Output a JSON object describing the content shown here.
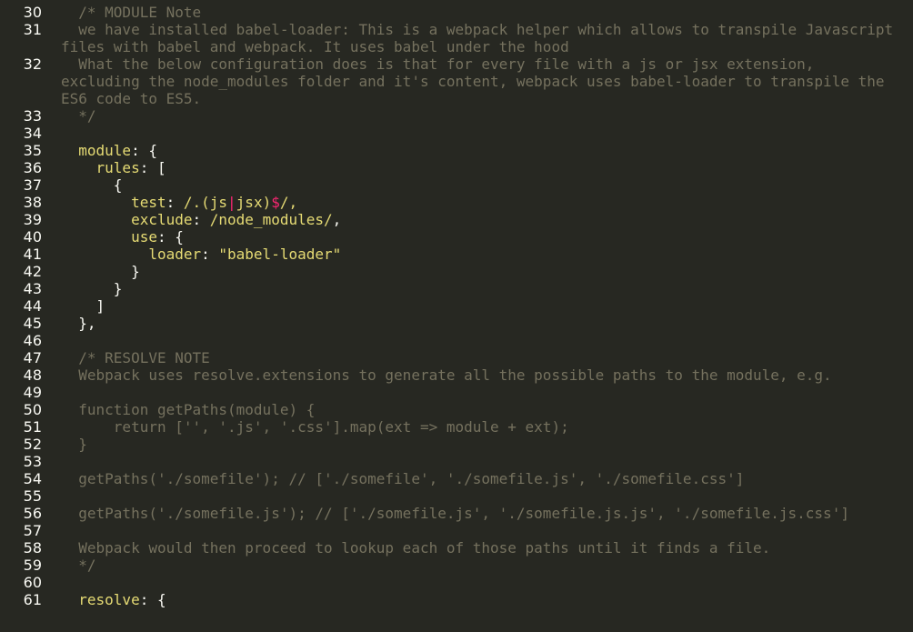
{
  "editor": {
    "lines": [
      {
        "n": "30",
        "text": "  /* MODULE Note"
      },
      {
        "n": "31",
        "text": "  we have installed babel-loader: This is a webpack helper which allows to transpile Javascript files with babel and webpack. It uses babel under the hood"
      },
      {
        "n": "32",
        "text": "  What the below configuration does is that for every file with a js or jsx extension, excluding the node_modules folder and it's content, webpack uses babel-loader to transpile the ES6 code to ES5."
      },
      {
        "n": "33",
        "text": "  */"
      },
      {
        "n": "34",
        "text": ""
      },
      {
        "n": "35",
        "seg": [
          "  ",
          "module",
          ": {"
        ]
      },
      {
        "n": "36",
        "seg": [
          "    ",
          "rules",
          ": ["
        ]
      },
      {
        "n": "37",
        "text": "      {"
      },
      {
        "n": "38",
        "seg": [
          "        ",
          "test",
          ": ",
          "/.(js",
          "|",
          "jsx)",
          "$",
          "/,"
        ]
      },
      {
        "n": "39",
        "seg": [
          "        ",
          "exclude",
          ": ",
          "/node_modules/",
          ","
        ]
      },
      {
        "n": "40",
        "seg": [
          "        ",
          "use",
          ": {"
        ]
      },
      {
        "n": "41",
        "seg": [
          "          ",
          "loader",
          ": ",
          "\"babel-loader\""
        ]
      },
      {
        "n": "42",
        "text": "        }"
      },
      {
        "n": "43",
        "text": "      }"
      },
      {
        "n": "44",
        "text": "    ]"
      },
      {
        "n": "45",
        "text": "  },"
      },
      {
        "n": "46",
        "text": ""
      },
      {
        "n": "47",
        "text": "  /* RESOLVE NOTE"
      },
      {
        "n": "48",
        "text": "  Webpack uses resolve.extensions to generate all the possible paths to the module, e.g."
      },
      {
        "n": "49",
        "text": ""
      },
      {
        "n": "50",
        "text": "  function getPaths(module) {"
      },
      {
        "n": "51",
        "text": "      return ['', '.js', '.css'].map(ext => module + ext);"
      },
      {
        "n": "52",
        "text": "  }"
      },
      {
        "n": "53",
        "text": ""
      },
      {
        "n": "54",
        "text": "  getPaths('./somefile'); // ['./somefile', './somefile.js', './somefile.css']"
      },
      {
        "n": "55",
        "text": ""
      },
      {
        "n": "56",
        "text": "  getPaths('./somefile.js'); // ['./somefile.js', './somefile.js.js', './somefile.js.css']"
      },
      {
        "n": "57",
        "text": ""
      },
      {
        "n": "58",
        "text": "  Webpack would then proceed to lookup each of those paths until it finds a file."
      },
      {
        "n": "59",
        "text": "  */"
      },
      {
        "n": "60",
        "text": ""
      },
      {
        "n": "61",
        "seg": [
          "  ",
          "resolve",
          ": {"
        ]
      }
    ]
  }
}
